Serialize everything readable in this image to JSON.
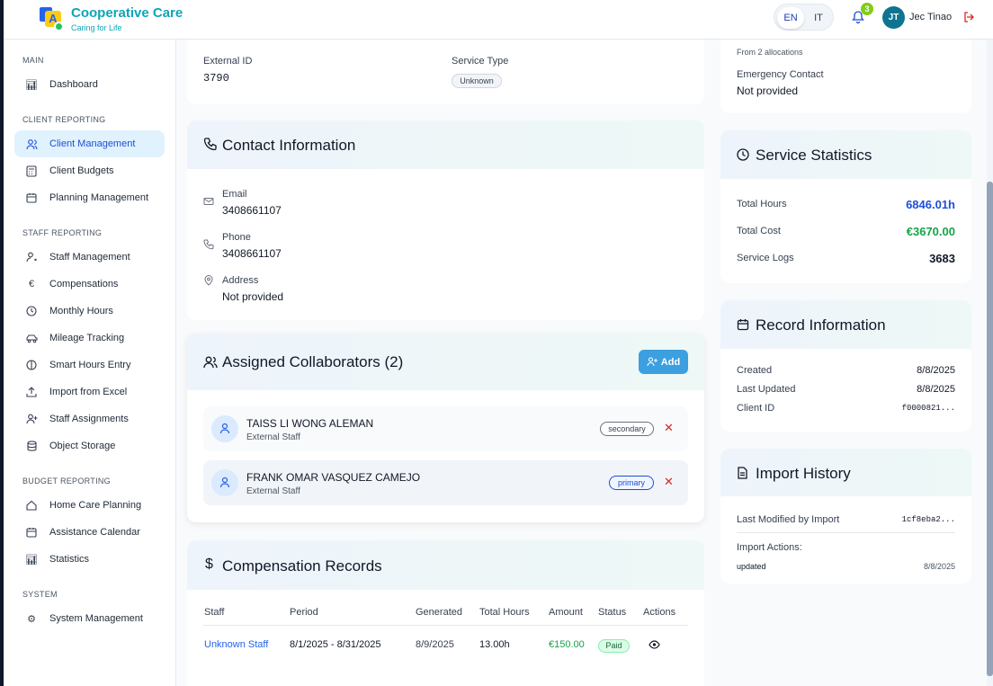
{
  "header": {
    "brand": "Cooperative Care",
    "tagline": "Caring for Life",
    "lang": [
      "EN",
      "IT"
    ],
    "lang_active": "EN",
    "notifications": "3",
    "avatar": "JT",
    "user": "Jec Tinao"
  },
  "sidebar": {
    "sections": {
      "main": "MAIN",
      "client": "CLIENT REPORTING",
      "staff": "STAFF REPORTING",
      "budget": "BUDGET REPORTING",
      "system": "SYSTEM"
    },
    "items": [
      "Dashboard",
      "Client Management",
      "Client Budgets",
      "Planning Management",
      "Staff Management",
      "Compensations",
      "Monthly Hours",
      "Mileage Tracking",
      "Smart Hours Entry",
      "Import from Excel",
      "Staff Assignments",
      "Object Storage",
      "Home Care Planning",
      "Assistance Calendar",
      "Statistics",
      "System Management"
    ]
  },
  "basic": {
    "external_id_label": "External ID",
    "external_id": "3790",
    "service_type_label": "Service Type",
    "service_type": "Unknown"
  },
  "contact": {
    "title": "Contact Information",
    "email_label": "Email",
    "email": "3408661107",
    "phone_label": "Phone",
    "phone": "3408661107",
    "address_label": "Address",
    "address": "Not provided"
  },
  "collaborators": {
    "title": "Assigned Collaborators (2)",
    "add": "Add",
    "items": [
      {
        "name": "TAISS LI WONG ALEMAN",
        "role": "External Staff",
        "tag": "secondary"
      },
      {
        "name": "FRANK OMAR VASQUEZ CAMEJO",
        "role": "External Staff",
        "tag": "primary"
      }
    ]
  },
  "compensation": {
    "title": "Compensation Records",
    "headers": [
      "Staff",
      "Period",
      "Generated",
      "Total Hours",
      "Amount",
      "Status",
      "Actions"
    ],
    "rows": [
      {
        "staff": "Unknown Staff",
        "period": "8/1/2025 - 8/31/2025",
        "generated": "8/9/2025",
        "hours": "13.00h",
        "amount": "€150.00",
        "status": "Paid"
      }
    ]
  },
  "right_top": {
    "allocations": "From 2 allocations",
    "emergency_label": "Emergency Contact",
    "emergency": "Not provided"
  },
  "stats": {
    "title": "Service Statistics",
    "hours_label": "Total Hours",
    "hours": "6846.01h",
    "cost_label": "Total Cost",
    "cost": "€3670.00",
    "logs_label": "Service Logs",
    "logs": "3683"
  },
  "record": {
    "title": "Record Information",
    "created_label": "Created",
    "created": "8/8/2025",
    "updated_label": "Last Updated",
    "updated": "8/8/2025",
    "client_id_label": "Client ID",
    "client_id": "f0000821..."
  },
  "import": {
    "title": "Import History",
    "modified_label": "Last Modified by Import",
    "modified": "1cf8eba2...",
    "actions_label": "Import Actions:",
    "action": "updated",
    "action_date": "8/8/2025"
  },
  "colors": {
    "accent": "#0ea5e9",
    "brand": "#0ea5b7",
    "green": "#16a34a",
    "blue": "#1d4ed8",
    "red": "#dc2626"
  }
}
